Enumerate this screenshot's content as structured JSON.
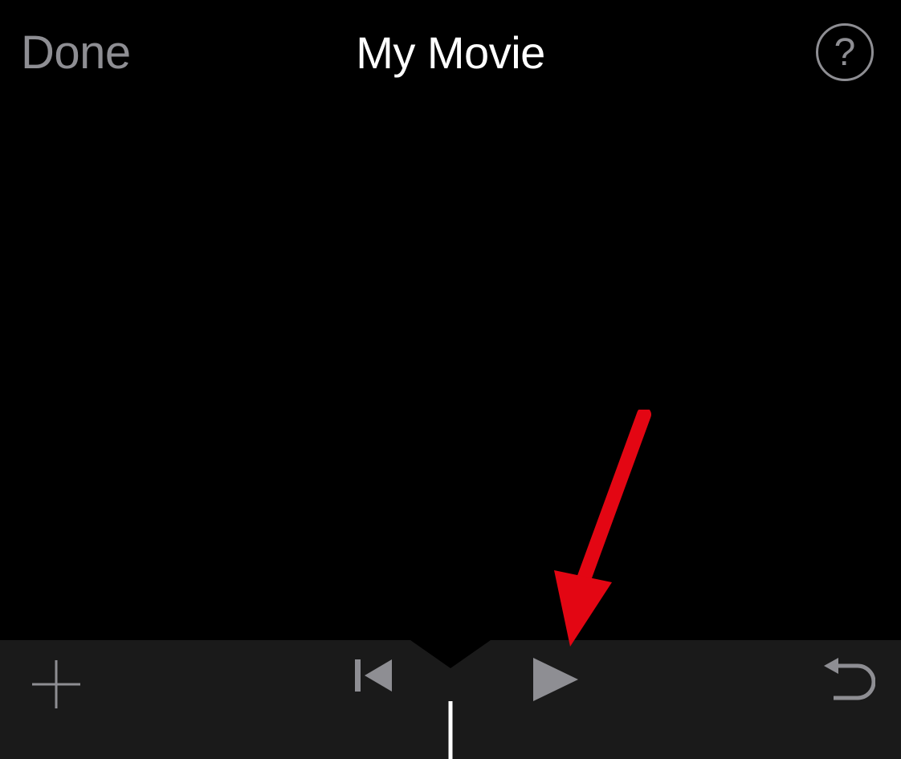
{
  "header": {
    "done_label": "Done",
    "title": "My Movie",
    "help_label": "?"
  },
  "icons": {
    "add": "plus-icon",
    "skip_back": "skip-to-start-icon",
    "play": "play-icon",
    "undo": "undo-icon",
    "help": "question-mark-icon"
  },
  "colors": {
    "background": "#000000",
    "toolbar_background": "#1a1a1a",
    "text_secondary": "#8e8e93",
    "text_primary": "#ffffff",
    "annotation": "#e30613"
  }
}
